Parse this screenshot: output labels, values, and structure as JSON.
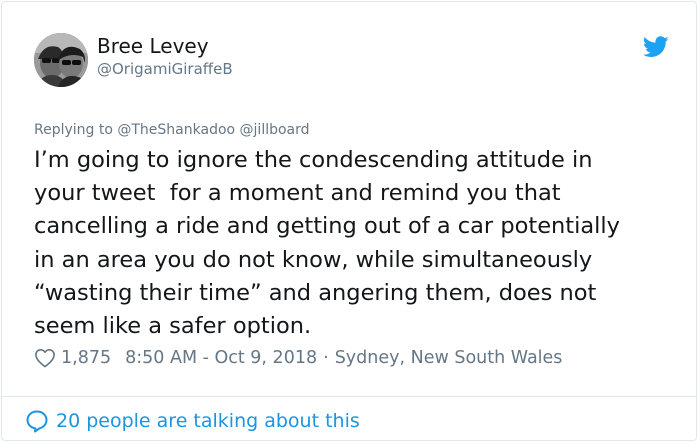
{
  "author": {
    "display_name": "Bree Levey",
    "handle": "@OrigamiGiraffeB"
  },
  "reply_context": "Replying to @TheShankadoo @jillboard",
  "tweet": {
    "lines": [
      "I’m going to ignore the condescending attitude in",
      "your tweet  for a moment and remind you that",
      "cancelling a ride and getting out of a car potentially",
      "in an area you do not know, while simultaneously",
      "“wasting their time” and angering them, does not",
      "seem like a safer option."
    ]
  },
  "meta": {
    "like_count": "1,875",
    "time": "8:50 AM - Oct 9, 2018",
    "separator": "·",
    "location": "Sydney, New South Wales"
  },
  "footer": {
    "conversation_label": "20 people are talking about this"
  },
  "icons": {
    "brand": "twitter-bird-icon",
    "like": "heart-outline-icon",
    "conversation": "speech-bubble-icon"
  },
  "colors": {
    "text": "#14171a",
    "secondary": "#657786",
    "accent": "#1b95e0",
    "bird": "#1da1f2",
    "border": "#e1e8ed"
  }
}
